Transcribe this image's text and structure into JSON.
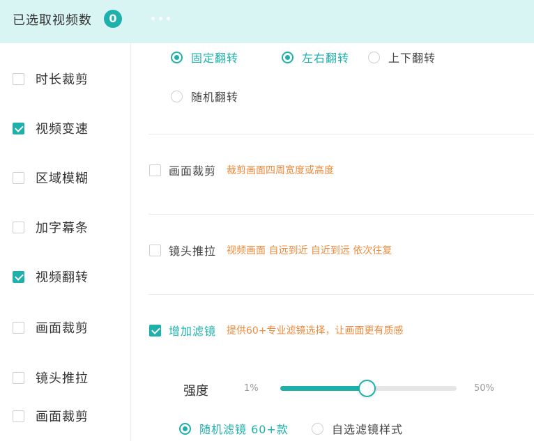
{
  "header": {
    "title": "已选取视频数",
    "count": "0"
  },
  "sidebar": {
    "items": [
      {
        "label": "时长裁剪",
        "checked": false
      },
      {
        "label": "视频变速",
        "checked": true
      },
      {
        "label": "区域模糊",
        "checked": false
      },
      {
        "label": "加字幕条",
        "checked": false
      },
      {
        "label": "视频翻转",
        "checked": true
      },
      {
        "label": "画面裁剪",
        "checked": false
      },
      {
        "label": "镜头推拉",
        "checked": false
      },
      {
        "label": "画面裁剪",
        "checked": false
      }
    ]
  },
  "flip": {
    "options": [
      {
        "label": "固定翻转",
        "selected": true
      },
      {
        "label": "左右翻转",
        "selected": true
      },
      {
        "label": "上下翻转",
        "selected": false
      },
      {
        "label": "随机翻转",
        "selected": false
      }
    ]
  },
  "crop": {
    "label": "画面裁剪",
    "desc": "裁剪画面四周宽度或高度",
    "checked": false
  },
  "zoom": {
    "label": "镜头推拉",
    "desc": "视频画面 自远到近 自近到远 依次往复",
    "checked": false
  },
  "filter": {
    "label": "增加滤镜",
    "desc": "提供60+专业滤镜选择，让画面更有质感",
    "checked": true,
    "strength_label": "强度",
    "min_label": "1%",
    "max_label": "50%",
    "strength_fraction": 0.49,
    "options": [
      {
        "label": "随机滤镜 60+款",
        "selected": true
      },
      {
        "label": "自选滤镜样式",
        "selected": false
      }
    ]
  },
  "colors": {
    "accent": "#1eb0ab",
    "header_bg": "#d8f4f3",
    "desc": "#f08a3c"
  }
}
